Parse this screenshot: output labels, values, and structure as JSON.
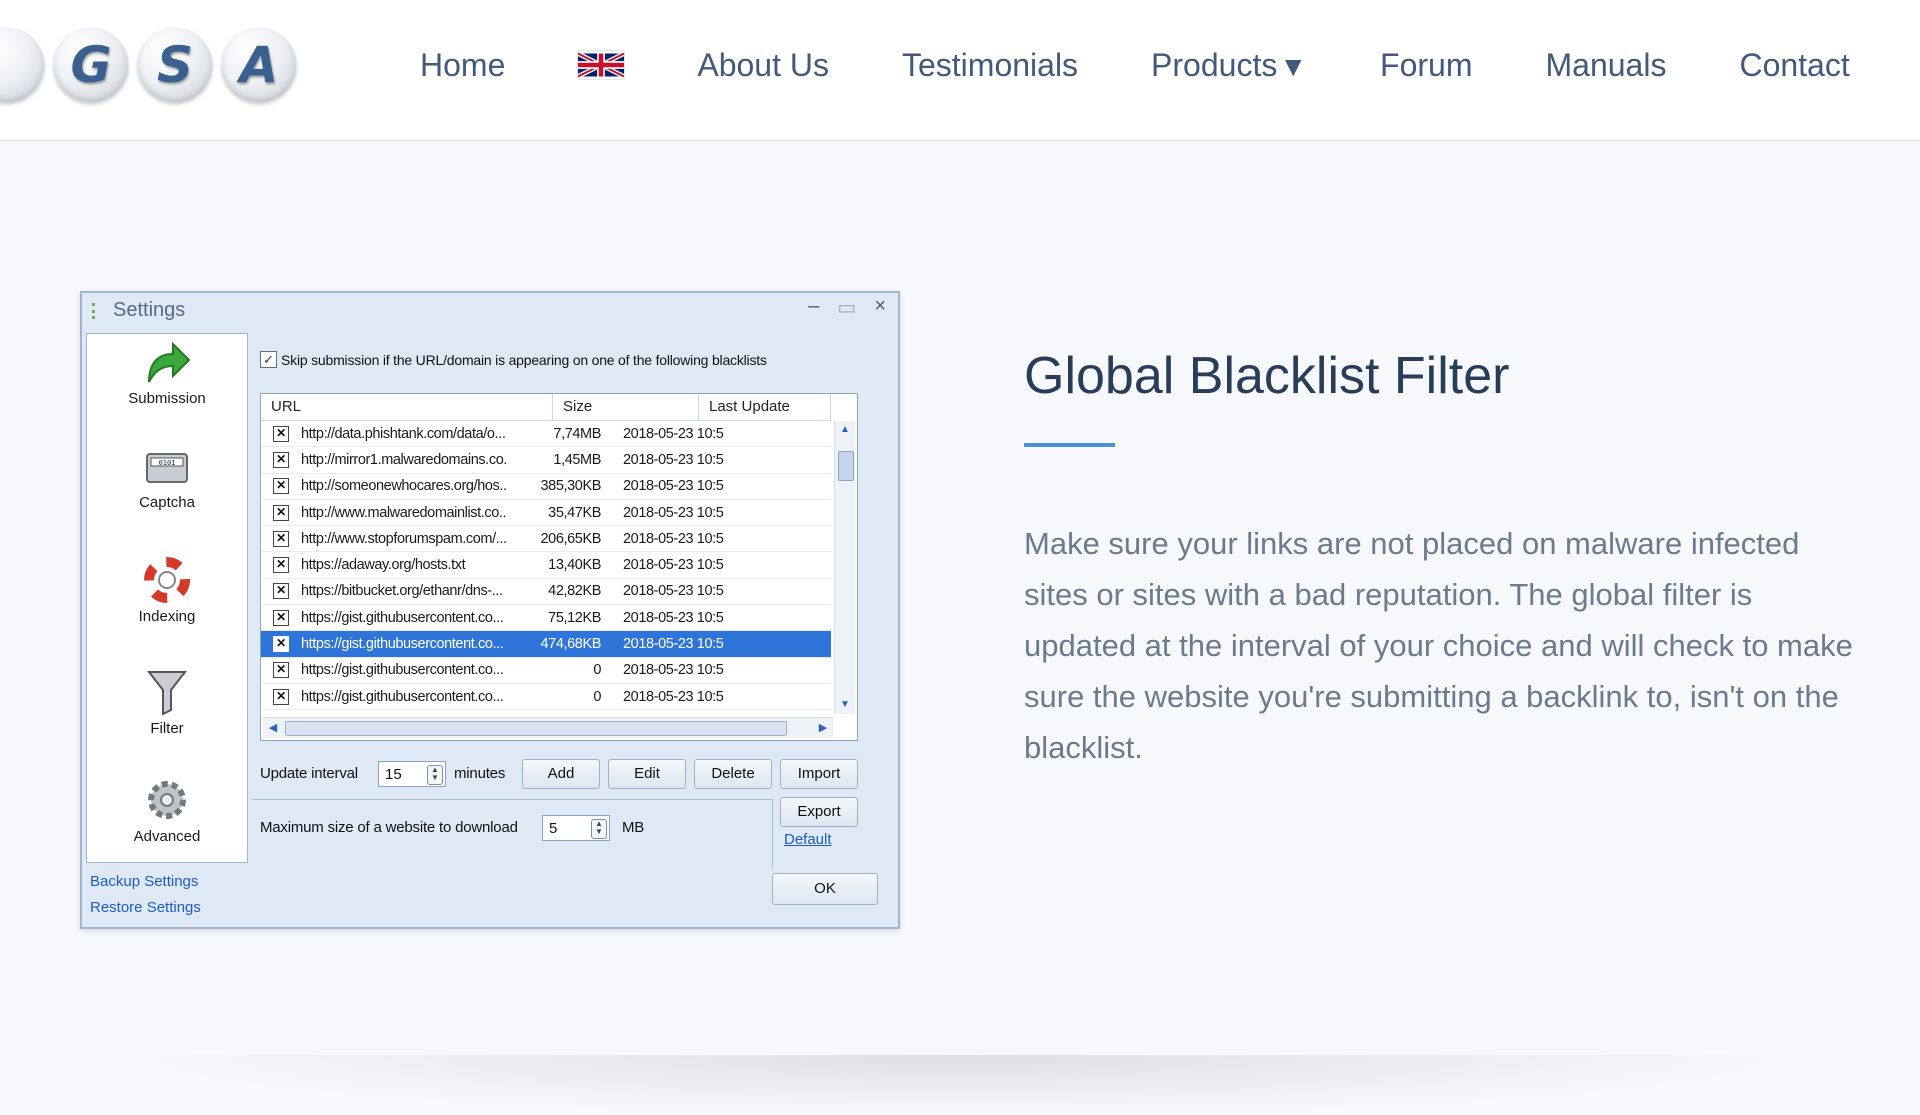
{
  "logo": {
    "letters": [
      "G",
      "S",
      "A"
    ]
  },
  "nav": {
    "home": "Home",
    "about": "About Us",
    "testimonials": "Testimonials",
    "products": "Products",
    "forum": "Forum",
    "manuals": "Manuals",
    "contact": "Contact"
  },
  "settings": {
    "title": "Settings",
    "sidebar": {
      "items": [
        "Submission",
        "Captcha",
        "Indexing",
        "Filter",
        "Advanced"
      ],
      "backup": "Backup Settings",
      "restore": "Restore Settings"
    },
    "skip_label": "Skip submission if the URL/domain is appearing on one of the following blacklists",
    "skip_checked": true,
    "columns": [
      "URL",
      "Size",
      "Last Update"
    ],
    "rows": [
      {
        "url": "http://data.phishtank.com/data/o...",
        "size": "7,74MB",
        "date": "2018-05-23 10:5"
      },
      {
        "url": "http://mirror1.malwaredomains.co...",
        "size": "1,45MB",
        "date": "2018-05-23 10:5"
      },
      {
        "url": "http://someonewhocares.org/hos...",
        "size": "385,30KB",
        "date": "2018-05-23 10:5"
      },
      {
        "url": "http://www.malwaredomainlist.co...",
        "size": "35,47KB",
        "date": "2018-05-23 10:5"
      },
      {
        "url": "http://www.stopforumspam.com/...",
        "size": "206,65KB",
        "date": "2018-05-23 10:5"
      },
      {
        "url": "https://adaway.org/hosts.txt",
        "size": "13,40KB",
        "date": "2018-05-23 10:5"
      },
      {
        "url": "https://bitbucket.org/ethanr/dns-...",
        "size": "42,82KB",
        "date": "2018-05-23 10:5"
      },
      {
        "url": "https://gist.githubusercontent.co...",
        "size": "75,12KB",
        "date": "2018-05-23 10:5"
      },
      {
        "url": "https://gist.githubusercontent.co...",
        "size": "474,68KB",
        "date": "2018-05-23 10:5",
        "selected": true
      },
      {
        "url": "https://gist.githubusercontent.co...",
        "size": "0",
        "date": "2018-05-23 10:5"
      },
      {
        "url": "https://gist.githubusercontent.co...",
        "size": "0",
        "date": "2018-05-23 10:5"
      }
    ],
    "update_interval_label": "Update interval",
    "update_interval_value": "15",
    "minutes_label": "minutes",
    "buttons": {
      "add": "Add",
      "edit": "Edit",
      "delete": "Delete",
      "import": "Import",
      "export": "Export",
      "ok": "OK"
    },
    "default_link": "Default",
    "max_size_label": "Maximum size of a website to download",
    "max_size_value": "5",
    "max_size_unit": "MB"
  },
  "feature": {
    "title": "Global Blacklist Filter",
    "description": "Make sure your links are not placed on malware infected sites or sites with a bad reputation. The global filter is updated at the interval of your choice and will check to make sure the website you're submitting a backlink to, isn't on the blacklist."
  },
  "colors": {
    "accent": "#4a90d9",
    "title": "#283d5a",
    "nav": "#40597d",
    "selection": "#2f74d9"
  }
}
